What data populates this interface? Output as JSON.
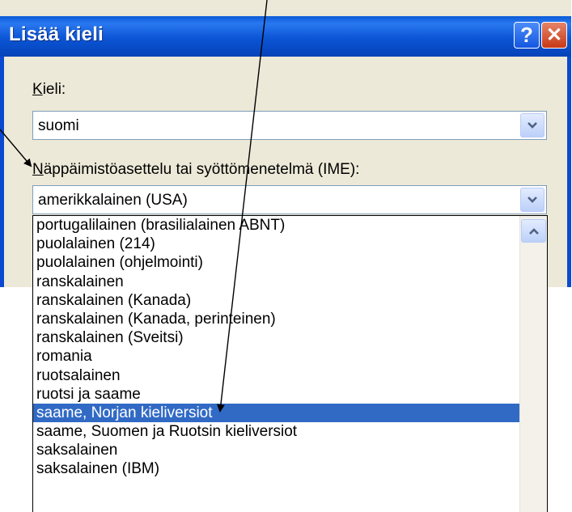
{
  "dialog": {
    "title": "Lisää kieli",
    "help_symbol": "?",
    "close_symbol": "✕"
  },
  "language": {
    "label_accel": "K",
    "label_rest": "ieli:",
    "value": "suomi"
  },
  "keyboard": {
    "label_accel": "N",
    "label_rest": "äppäimistöasettelu tai syöttömenetelmä (IME):",
    "value": "amerikkalainen (USA)"
  },
  "dropdown": {
    "items": [
      "portugalilainen (brasilialainen ABNT)",
      "puolalainen (214)",
      "puolalainen (ohjelmointi)",
      "ranskalainen",
      "ranskalainen (Kanada)",
      "ranskalainen (Kanada, perinteinen)",
      "ranskalainen (Sveitsi)",
      "romania",
      "ruotsalainen",
      "ruotsi ja saame",
      "saame, Norjan kieliversiot",
      "saame, Suomen ja Ruotsin kieliversiot",
      "saksalainen",
      "saksalainen (IBM)"
    ],
    "selected_item": "saame, Norjan kieliversiot"
  },
  "colors": {
    "titlebar": "#0b55d6",
    "selection": "#316ac5",
    "dialog_background": "#ece9d8"
  }
}
